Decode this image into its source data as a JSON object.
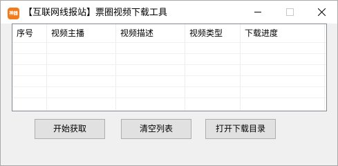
{
  "window": {
    "title": "【互联网线报站】票圈视频下载工具",
    "app_icon_text": "神器",
    "colors": {
      "app_icon": "#f27a1a",
      "titlebar": "#ffffff",
      "body": "#f0f0f0"
    }
  },
  "controls": {
    "minimize_icon": "minimize-icon",
    "maximize_icon": "maximize-icon",
    "close_icon": "close-icon"
  },
  "list": {
    "columns": [
      "序号",
      "视频主播",
      "视频描述",
      "视频类型",
      "下载进度"
    ],
    "rows": []
  },
  "buttons": {
    "start": "开始获取",
    "clear": "清空列表",
    "open_dir": "打开下载目录"
  }
}
